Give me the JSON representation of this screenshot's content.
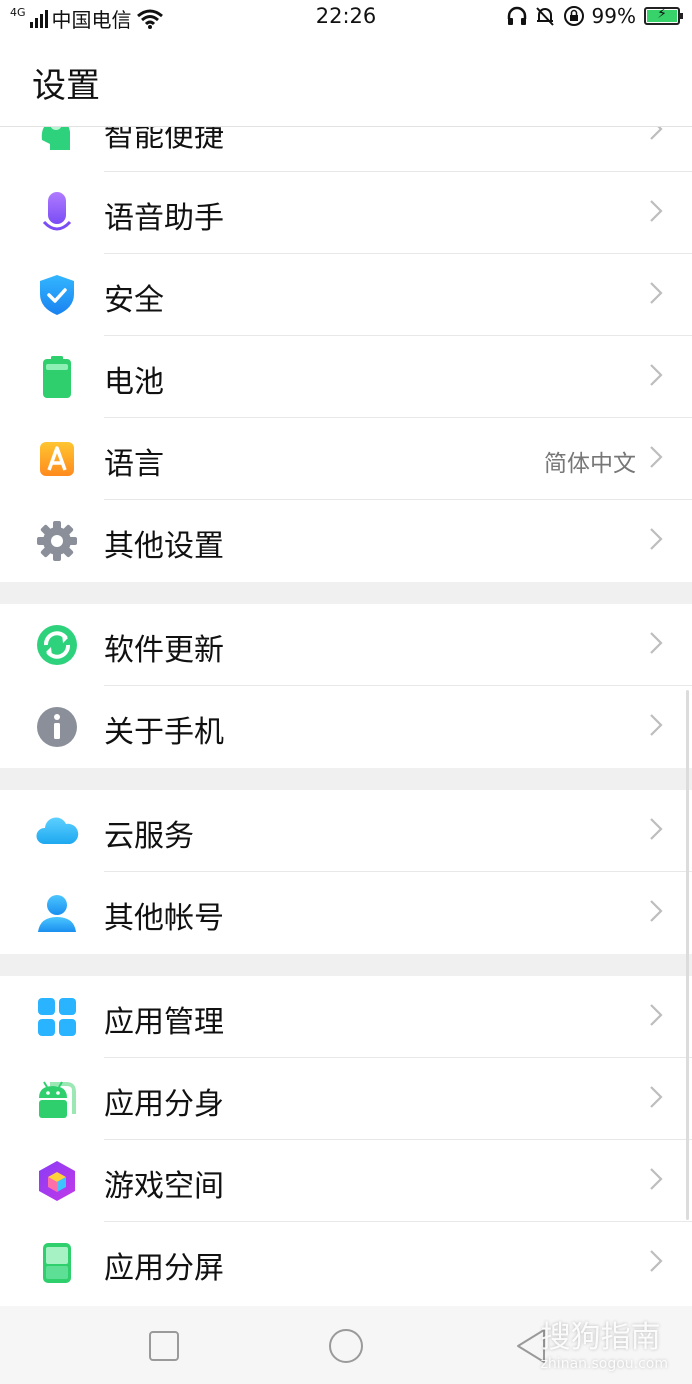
{
  "status_bar": {
    "network_type": "4G",
    "carrier": "中国电信",
    "time": "22:26",
    "battery_percent": "99%",
    "battery_level": 0.99,
    "icons": [
      "signal-icon",
      "wifi-icon",
      "headphones-icon",
      "mute-bell-icon",
      "rotation-lock-icon",
      "battery-charging-icon"
    ]
  },
  "header": {
    "title": "设置"
  },
  "sections": [
    {
      "items": [
        {
          "label": "智能便捷",
          "icon": "smart-assist-icon",
          "value": ""
        },
        {
          "label": "语音助手",
          "icon": "microphone-icon",
          "value": ""
        },
        {
          "label": "安全",
          "icon": "shield-icon",
          "value": ""
        },
        {
          "label": "电池",
          "icon": "battery-icon",
          "value": ""
        },
        {
          "label": "语言",
          "icon": "language-icon",
          "value": "简体中文"
        },
        {
          "label": "其他设置",
          "icon": "gear-icon",
          "value": ""
        }
      ]
    },
    {
      "items": [
        {
          "label": "软件更新",
          "icon": "update-icon",
          "value": ""
        },
        {
          "label": "关于手机",
          "icon": "info-icon",
          "value": ""
        }
      ]
    },
    {
      "items": [
        {
          "label": "云服务",
          "icon": "cloud-icon",
          "value": ""
        },
        {
          "label": "其他帐号",
          "icon": "account-icon",
          "value": ""
        }
      ]
    },
    {
      "items": [
        {
          "label": "应用管理",
          "icon": "app-grid-icon",
          "value": ""
        },
        {
          "label": "应用分身",
          "icon": "android-clone-icon",
          "value": ""
        },
        {
          "label": "游戏空间",
          "icon": "game-cube-icon",
          "value": ""
        },
        {
          "label": "应用分屏",
          "icon": "split-screen-icon",
          "value": ""
        }
      ]
    }
  ],
  "nav_bar": {
    "buttons": [
      "recent-apps-button",
      "home-button",
      "back-button"
    ],
    "watermark": "搜狗指南",
    "watermark_url": "zhinan.sogou.com"
  },
  "colors": {
    "accent_green": "#37d26a",
    "divider": "#e8e8e8",
    "section_gap": "#f0f0f0",
    "secondary_text": "#777777"
  }
}
